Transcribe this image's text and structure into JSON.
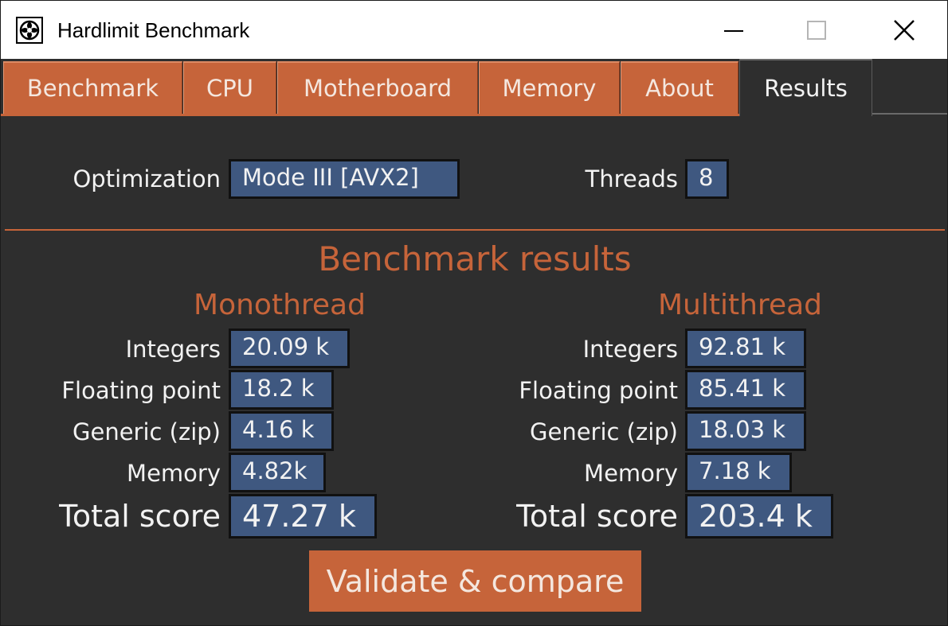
{
  "window": {
    "title": "Hardlimit Benchmark",
    "controls": {
      "minimize_icon": "minimize-icon",
      "maximize_icon": "maximize-icon",
      "close_icon": "close-icon"
    }
  },
  "tabs": [
    {
      "label": "Benchmark",
      "active": false
    },
    {
      "label": "CPU",
      "active": false
    },
    {
      "label": "Motherboard",
      "active": false
    },
    {
      "label": "Memory",
      "active": false
    },
    {
      "label": "About",
      "active": false
    },
    {
      "label": "Results",
      "active": true
    }
  ],
  "settings": {
    "optimization_label": "Optimization",
    "optimization_value": "Mode III [AVX2]",
    "threads_label": "Threads",
    "threads_value": "8"
  },
  "results": {
    "heading": "Benchmark results",
    "mono": {
      "heading": "Monothread",
      "integers_label": "Integers",
      "integers_value": "20.09 k",
      "floating_label": "Floating point",
      "floating_value": "18.2 k",
      "generic_label": "Generic (zip)",
      "generic_value": "4.16 k",
      "memory_label": "Memory",
      "memory_value": "4.82k",
      "total_label": "Total score",
      "total_value": "47.27 k"
    },
    "multi": {
      "heading": "Multithread",
      "integers_label": "Integers",
      "integers_value": "92.81 k",
      "floating_label": "Floating point",
      "floating_value": "85.41 k",
      "generic_label": "Generic (zip)",
      "generic_value": "18.03 k",
      "memory_label": "Memory",
      "memory_value": "7.18 k",
      "total_label": "Total score",
      "total_value": "203.4 k"
    }
  },
  "action": {
    "validate_label": "Validate & compare"
  },
  "colors": {
    "accent": "#c6643a",
    "background": "#2e2e2e",
    "field_fill": "#3f5880",
    "text": "#f2f2f2"
  }
}
